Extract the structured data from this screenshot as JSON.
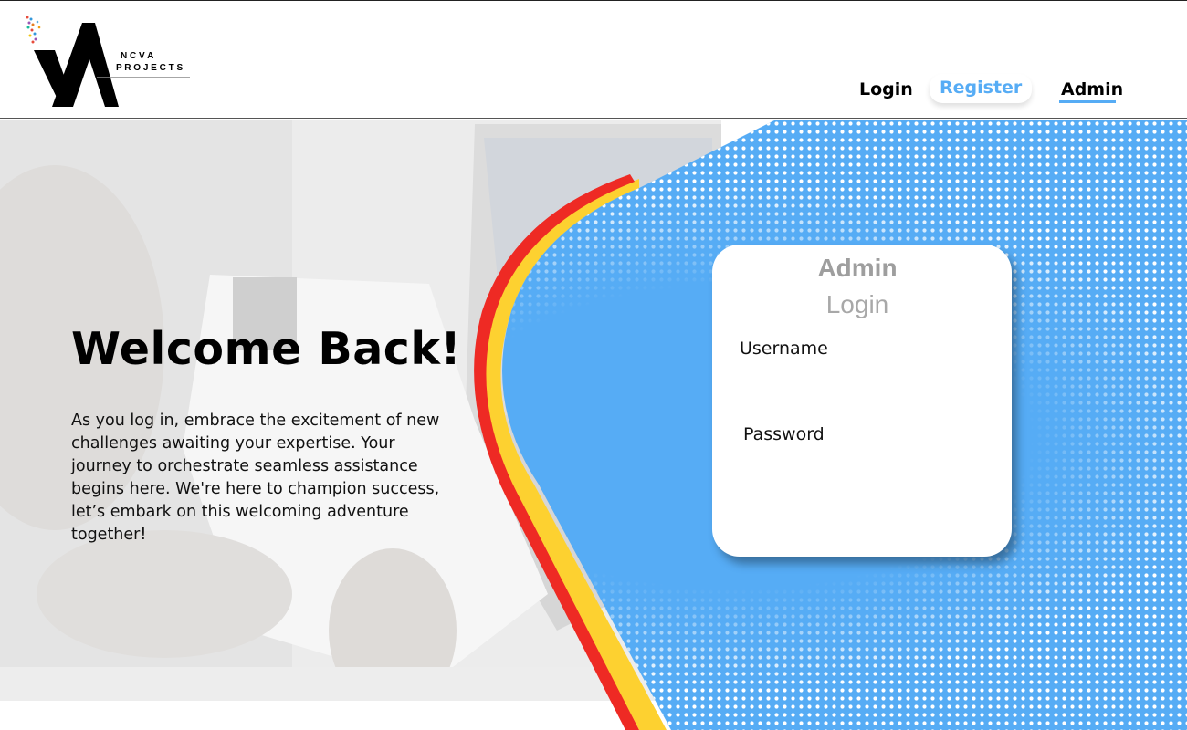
{
  "brand": {
    "logo_letters": "VA",
    "logo_line1": "N C V A",
    "logo_line2": "P R O J E C T S"
  },
  "nav": {
    "login": "Login",
    "register": "Register",
    "admin": "Admin",
    "active": "Admin"
  },
  "hero": {
    "title": "Welcome Back!",
    "paragraph": "As you log in, embrace the excitement of new challenges awaiting your expertise. Your journey to orchestrate seamless assistance begins here. We're here to champion  success, let’s embark on this welcoming adventure together!"
  },
  "login_card": {
    "title_line1": "Admin",
    "title_line2": "Login",
    "username_label": "Username",
    "username_value": "",
    "password_label": "Password",
    "password_value": ""
  },
  "colors": {
    "accent_blue": "#56acf5",
    "stripe_yellow": "#fdd130",
    "stripe_red": "#ee2a24",
    "text_dark": "#000000",
    "card_title_gray": "#9e9e9e"
  }
}
